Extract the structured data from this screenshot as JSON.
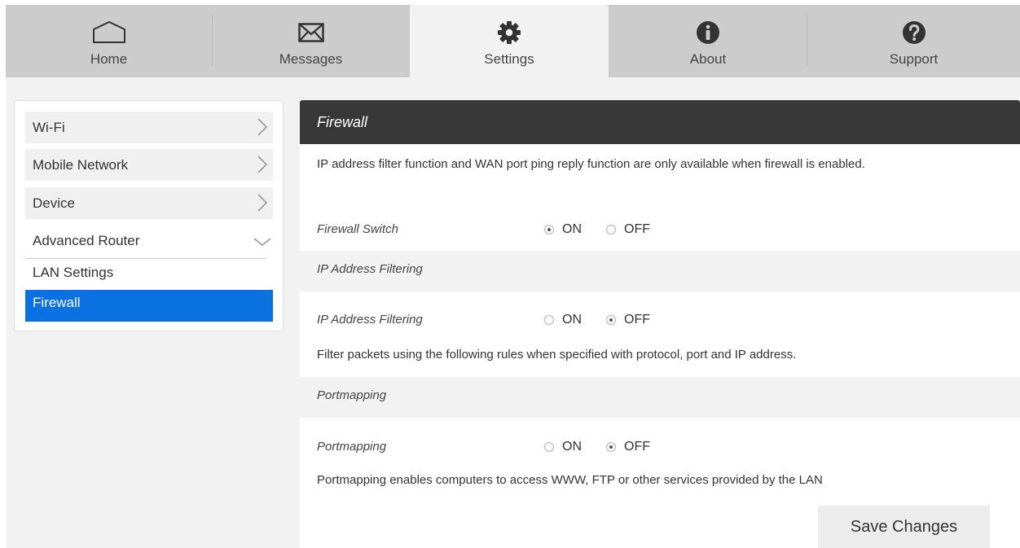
{
  "nav": {
    "tabs": [
      {
        "label": "Home",
        "icon": "home-icon"
      },
      {
        "label": "Messages",
        "icon": "envelope-icon"
      },
      {
        "label": "Settings",
        "icon": "gear-icon"
      },
      {
        "label": "About",
        "icon": "info-icon"
      },
      {
        "label": "Support",
        "icon": "question-icon"
      }
    ],
    "active": "Settings"
  },
  "sidebar": {
    "items": [
      {
        "label": "Wi-Fi"
      },
      {
        "label": "Mobile Network"
      },
      {
        "label": "Device"
      },
      {
        "label": "Advanced Router"
      }
    ],
    "sub_items": [
      {
        "label": "LAN Settings"
      },
      {
        "label": "Firewall"
      }
    ],
    "active": "Firewall"
  },
  "panel": {
    "title": "Firewall",
    "intro": "IP address filter function and WAN port ping reply function are only available when firewall is enabled.",
    "firewall_switch": {
      "label": "Firewall Switch",
      "on_label": "ON",
      "off_label": "OFF",
      "selected": "ON"
    },
    "ip_filtering_section": {
      "title": "IP Address Filtering"
    },
    "ip_filtering": {
      "label": "IP Address Filtering",
      "on_label": "ON",
      "off_label": "OFF",
      "selected": "OFF"
    },
    "ip_filtering_desc": "Filter packets using the following rules when specified with protocol, port and IP address.",
    "portmapping_section": {
      "title": "Portmapping"
    },
    "portmapping": {
      "label": "Portmapping",
      "on_label": "ON",
      "off_label": "OFF",
      "selected": "OFF"
    },
    "portmapping_desc": "Portmapping enables computers to access WWW, FTP or other services provided by the LAN",
    "save_label": "Save Changes"
  },
  "colors": {
    "accent": "#0a72e0",
    "header": "#383838",
    "nav": "#cccccc"
  }
}
